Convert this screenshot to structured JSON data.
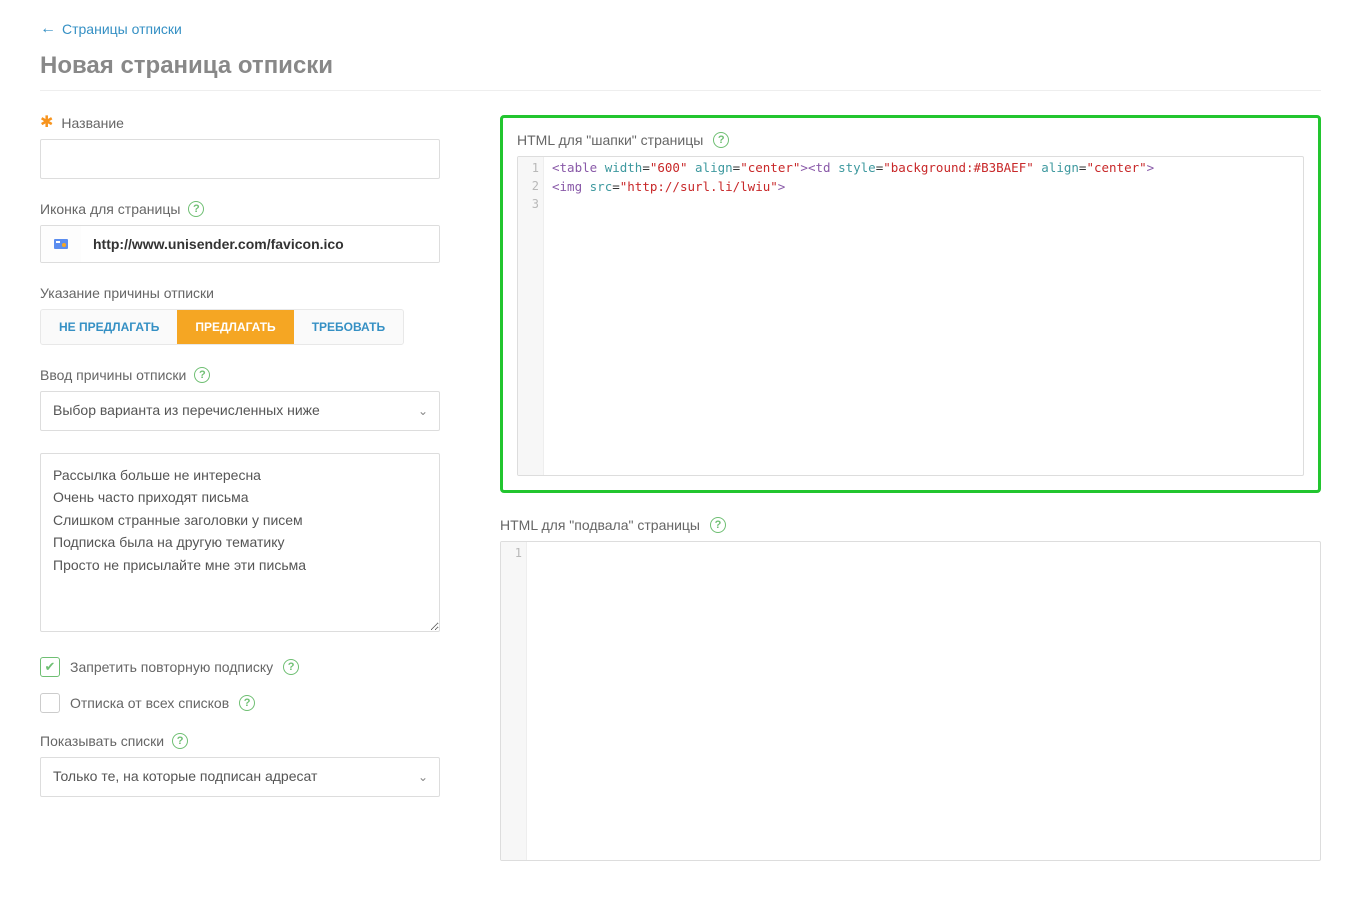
{
  "back_link": "Страницы отписки",
  "page_title": "Новая страница отписки",
  "fields": {
    "name_label": "Название",
    "name_value": "",
    "icon_label": "Иконка для страницы",
    "icon_value": "http://www.unisender.com/favicon.ico",
    "reason_prompt_label": "Указание причины отписки",
    "reason_buttons": {
      "dont_suggest": "НЕ ПРЕДЛАГАТЬ",
      "suggest": "ПРЕДЛАГАТЬ",
      "require": "ТРЕБОВАТЬ"
    },
    "reason_input_label": "Ввод причины отписки",
    "reason_select_value": "Выбор варианта из перечисленных ниже",
    "reasons_text": "Рассылка больше не интересна\nОчень часто приходят письма\nСлишком странные заголовки у писем\nПодписка была на другую тематику\nПросто не присылайте мне эти письма",
    "forbid_resub_label": "Запретить повторную подписку",
    "unsub_all_label": "Отписка от всех списков",
    "show_lists_label": "Показывать списки",
    "show_lists_value": "Только те, на которые подписан адресат"
  },
  "editors": {
    "header_label": "HTML для \"шапки\" страницы",
    "footer_label": "HTML для \"подвала\" страницы",
    "header_gutter": [
      "1",
      "2",
      "3"
    ],
    "footer_gutter": [
      "1"
    ],
    "header_code": {
      "table_width": "\"600\"",
      "table_align": "\"center\"",
      "td_style": "\"background:#B3BAEF\"",
      "td_align": "\"center\"",
      "img_src": "\"http://surl.li/lwiu\""
    }
  }
}
